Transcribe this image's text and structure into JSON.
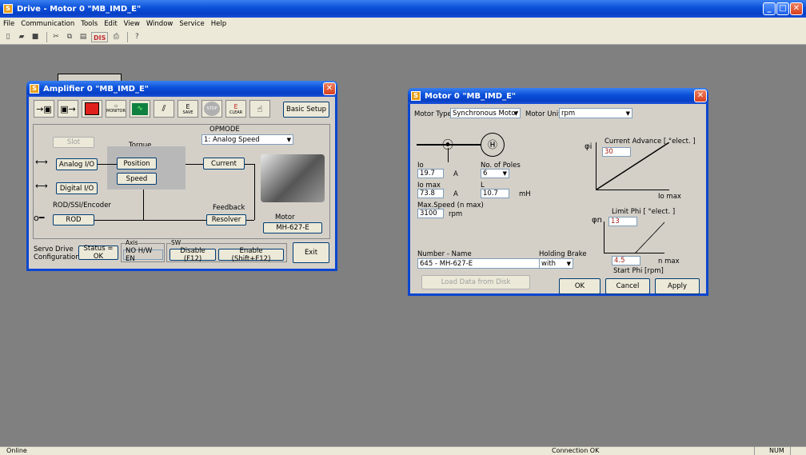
{
  "app": {
    "title": "Drive - Motor 0 \"MB_IMD_E\"",
    "icon": "app-logo-icon"
  },
  "menu": [
    "File",
    "Communication",
    "Tools",
    "Edit",
    "View",
    "Window",
    "Service",
    "Help"
  ],
  "toolbar": {
    "dis_label": "DIS",
    "icons": [
      "new-file-icon",
      "open-folder-icon",
      "save-icon",
      "cut-icon",
      "copy-icon",
      "paste-icon",
      "print-icon",
      "help-icon"
    ]
  },
  "statusbar": {
    "left": "Online",
    "connection": "Connection OK",
    "num": "NUM"
  },
  "amp": {
    "title": "Amplifier 0 \"MB_IMD_E\"",
    "basic_setup": "Basic Setup",
    "icon_labels": {
      "monitor": "MONITOR",
      "save": "SAVE",
      "stop": "STOP",
      "clear": "CLEAR"
    },
    "opmode_label": "OPMODE",
    "opmode_value": "1: Analog Speed",
    "slot": "Slot",
    "torque": "Torque",
    "position": "Position",
    "speed": "Speed",
    "current": "Current",
    "analog_io": "Analog I/O",
    "digital_io": "Digital I/O",
    "rod_ssi": "ROD/SSI/Encoder",
    "rod": "ROD",
    "feedback": "Feedback",
    "resolver": "Resolver",
    "motor": "Motor",
    "motor_name": "MH-627-E",
    "servo_line1": "Servo Drive",
    "servo_line2": "Configuration",
    "status": "Status = OK",
    "axis_label": "Axis",
    "axis_value": "NO H/W EN",
    "sw_label": "SW",
    "disable": "Disable (F12)",
    "enable": "Enable (Shift+F12)",
    "exit": "Exit"
  },
  "motor": {
    "title": "Motor 0 \"MB_IMD_E\"",
    "motor_type_label": "Motor Type",
    "motor_type": "Synchronous Motor",
    "motor_unit_label": "Motor Unit",
    "motor_unit": "rpm",
    "io_label": "Io",
    "io_value": "19.7",
    "io_unit": "A",
    "poles_label": "No. of Poles",
    "poles_value": "6",
    "iomax_label": "Io max",
    "iomax_value": "73.8",
    "iomax_unit": "A",
    "l_label": "L",
    "l_value": "10.7",
    "l_unit": "mH",
    "maxspeed_label": "Max.Speed (n max)",
    "maxspeed_value": "3100",
    "maxspeed_unit": "rpm",
    "phi_i": "φi",
    "current_advance_label": "Current Advance [ °elect. ]",
    "current_advance_value": "30",
    "io_max_axis": "Io max",
    "phi_n": "φn",
    "limit_phi_label": "Limit Phi [ °elect. ]",
    "limit_phi_value": "13",
    "start_phi_value": "4.5",
    "n_max_axis": "n max",
    "start_phi_label": "Start Phi [rpm]",
    "number_name_label": "Number - Name",
    "number_name": "645 - MH-627-E",
    "holding_brake_label": "Holding Brake",
    "holding_brake": "with",
    "load_disk": "Load Data from Disk",
    "ok": "OK",
    "cancel": "Cancel",
    "apply": "Apply"
  }
}
